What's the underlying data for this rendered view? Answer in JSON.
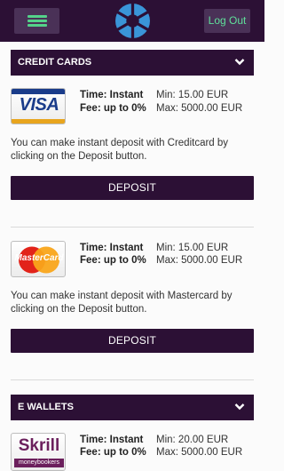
{
  "header": {
    "logout_label": "Log Out",
    "menu_icon": "hamburger-menu-icon",
    "logo_icon": "brand-logo-icon",
    "accent_color": "#2c1035",
    "green_color": "#54d28a"
  },
  "sections": {
    "credit_cards": {
      "title": "CREDIT CARDS",
      "methods": [
        {
          "logo_text": "VISA",
          "time": "Time: Instant",
          "fee": "Fee: up to 0%",
          "min": "Min: 15.00 EUR",
          "max": "Max: 5000.00 EUR",
          "description": "You can make instant deposit with Creditcard by clicking on the Deposit button.",
          "button": "DEPOSIT"
        },
        {
          "logo_text": "MasterCard",
          "time": "Time: Instant",
          "fee": "Fee: up to 0%",
          "min": "Min: 15.00 EUR",
          "max": "Max: 5000.00 EUR",
          "description": "You can make instant deposit with Mastercard by clicking on the Deposit button.",
          "button": "DEPOSIT"
        }
      ]
    },
    "e_wallets": {
      "title": "E WALLETS",
      "methods": [
        {
          "logo_text": "Skrill",
          "logo_subtext": "moneybookers",
          "time": "Time: Instant",
          "fee": "Fee: up to 0%",
          "min": "Min: 20.00 EUR",
          "max": "Max: 5000.00 EUR"
        }
      ]
    }
  }
}
